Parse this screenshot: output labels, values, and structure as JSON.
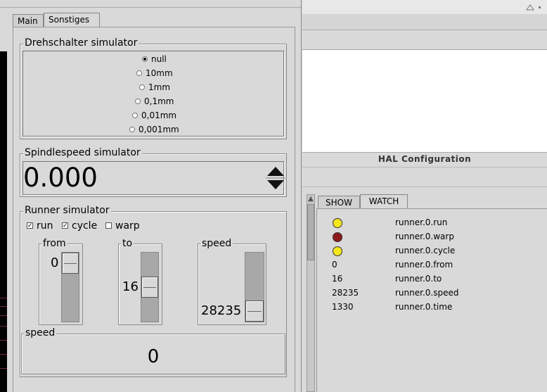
{
  "tabs": [
    {
      "label": "Main"
    },
    {
      "label": "Sonstiges"
    }
  ],
  "drehschalter": {
    "title": "Drehschalter simulator",
    "options": [
      "null",
      "10mm",
      "1mm",
      "0,1mm",
      "0,01mm",
      "0,001mm"
    ],
    "selected": "null"
  },
  "spindle": {
    "title": "Spindlespeed simulator",
    "value": "0.000"
  },
  "runner": {
    "title": "Runner simulator",
    "checks": [
      {
        "label": "run",
        "checked": true
      },
      {
        "label": "cycle",
        "checked": true
      },
      {
        "label": "warp",
        "checked": false
      }
    ],
    "from": {
      "label": "from",
      "value": "0",
      "fraction": 0.0
    },
    "to": {
      "label": "to",
      "value": "16",
      "fraction": 0.5
    },
    "speed": {
      "label": "speed",
      "value": "28235",
      "fraction": 1.0
    },
    "speed_display": {
      "label": "speed",
      "value": "0"
    }
  },
  "hal": {
    "title": "HAL Configuration",
    "tabs": [
      {
        "label": "SHOW"
      },
      {
        "label": "WATCH"
      }
    ],
    "watch": [
      {
        "type": "led",
        "color": "#f5e61e",
        "name": "runner.0.run"
      },
      {
        "type": "led",
        "color": "#8b1a1a",
        "name": "runner.0.warp"
      },
      {
        "type": "led",
        "color": "#f5e61e",
        "name": "runner.0.cycle"
      },
      {
        "type": "value",
        "value": "0",
        "name": "runner.0.from"
      },
      {
        "type": "value",
        "value": "16",
        "name": "runner.0.to"
      },
      {
        "type": "value",
        "value": "28235",
        "name": "runner.0.speed"
      },
      {
        "type": "value",
        "value": "1330",
        "name": "runner.0.time"
      }
    ]
  },
  "colors": {
    "led_on": "#f5e61e",
    "led_off": "#8b1a1a"
  }
}
